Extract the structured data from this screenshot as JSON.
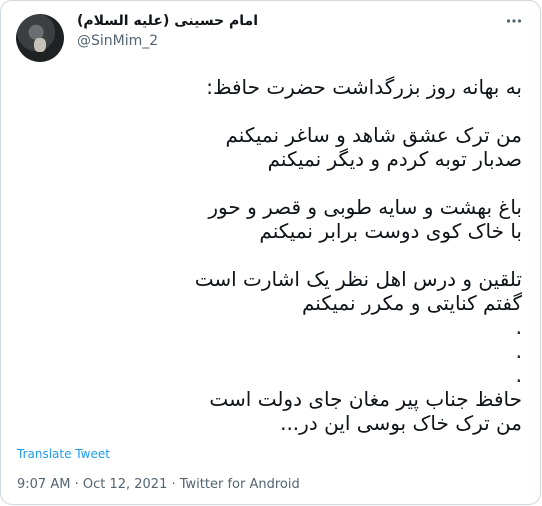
{
  "author": {
    "display_name": "امام حسینی (علیه السلام)",
    "handle": "@SinMim_2"
  },
  "tweet": {
    "text": "به بهانه روز بزرگداشت حضرت حافظ:\n\nمن ترک عشق شاهد و ساغر نمیکنم\nصدبار توبه کردم و دیگر نمیکنم\n\nباغ بهشت و سایه طوبی و قصر و حور\nبا خاک کوی دوست برابر نمیکنم\n\nتلقین و درس اهل نظر یک اشارت است\nگفتم کنایتی و مکرر نمیکنم\n.\n.\n.\nحافظ جناب پیر مغان جای دولت است\nمن ترک خاک بوسی این در...",
    "translate_label": "Translate Tweet"
  },
  "meta": {
    "time": "9:07 AM",
    "sep1": " · ",
    "date": "Oct 12, 2021",
    "sep2": " · ",
    "source": "Twitter for Android"
  },
  "icons": {
    "more": "more-horizontal-icon",
    "avatar": "avatar-image"
  },
  "colors": {
    "link": "#1d9bf0",
    "secondary_text": "#536471",
    "border": "#cfd9de"
  }
}
